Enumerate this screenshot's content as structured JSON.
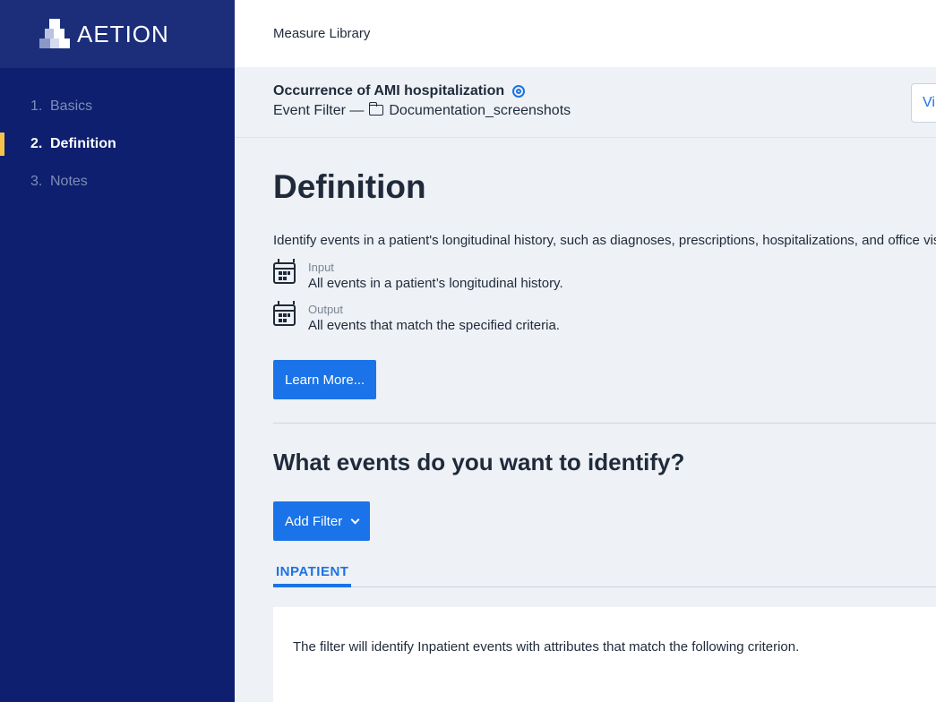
{
  "brand": {
    "name": "AETION"
  },
  "sidebar": {
    "items": [
      {
        "num": "1.",
        "label": "Basics"
      },
      {
        "num": "2.",
        "label": "Definition"
      },
      {
        "num": "3.",
        "label": "Notes"
      }
    ],
    "active_index": 1
  },
  "topbar": {
    "breadcrumb": "Measure Library"
  },
  "header": {
    "title": "Occurrence of AMI hospitalization",
    "type": "Event Filter —",
    "folder": "Documentation_screenshots",
    "view_button": "Vi"
  },
  "definition": {
    "heading": "Definition",
    "description": "Identify events in a patient's longitudinal history, such as diagnoses, prescriptions, hospitalizations, and office vis",
    "input_label": "Input",
    "input_value": "All events in a patient’s longitudinal history.",
    "output_label": "Output",
    "output_value": "All events that match the specified criteria.",
    "learn_more": "Learn More..."
  },
  "identify": {
    "heading": "What events do you want to identify?",
    "add_filter": "Add Filter",
    "tab": "INPATIENT",
    "card_text": "The filter will identify Inpatient events with attributes that match the following criterion."
  },
  "colors": {
    "sidebar_bg": "#0d1f6e",
    "accent": "#1a73e8",
    "active_marker": "#f5c24a"
  }
}
